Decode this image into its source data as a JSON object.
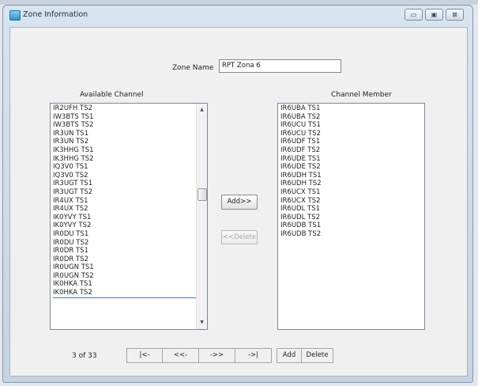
{
  "window": {
    "title": "Zone Information",
    "controls": {
      "minimize": "▭",
      "maximize": "▣",
      "close": "⊠"
    }
  },
  "zone_name": {
    "label": "Zone Name",
    "value": "RPT Zona 6"
  },
  "available": {
    "label": "Available Channel",
    "items": [
      "IR2UFH TS2",
      "IW3BTS TS1",
      "IW3BTS TS2",
      "IR3UN TS1",
      "IR3UN TS2",
      "IK3HHG TS1",
      "IK3HHG TS2",
      "IQ3V0 TS1",
      "IQ3V0 TS2",
      "IR3UGT TS1",
      "IR3UGT TS2",
      "IR4UX TS1",
      "IR4UX TS2",
      "IK0YVY TS1",
      "IK0YVY TS2",
      "IR0DU TS1",
      "IR0DU TS2",
      "IR0DR TS1",
      "IR0DR TS2",
      "IR0UGN TS1",
      "IR0UGN TS2",
      "IK0HKA TS1",
      "IK0HKA TS2"
    ]
  },
  "members": {
    "label": "Channel Member",
    "items": [
      "IR6UBA TS1",
      "IR6UBA TS2",
      "IR6UCU TS1",
      "IR6UCU TS2",
      "IR6UDF TS1",
      "IR6UDF TS2",
      "IR6UDE TS1",
      "IR6UDE TS2",
      "IR6UDH TS1",
      "IR6UDH TS2",
      "IR6UCX TS1",
      "IR6UCX TS2",
      "IR6UDL TS1",
      "IR6UDL TS2",
      "IR6UDB TS1",
      "IR6UDB TS2"
    ]
  },
  "actions": {
    "add": "Add>>",
    "delete": "<<Delete"
  },
  "scroll": {
    "up": "▲",
    "down": "▼"
  },
  "nav": {
    "counter": "3 of 33",
    "first": "|<-",
    "prev": "<<-",
    "next": "->>",
    "last": "->|",
    "add": "Add",
    "delete": "Delete"
  }
}
